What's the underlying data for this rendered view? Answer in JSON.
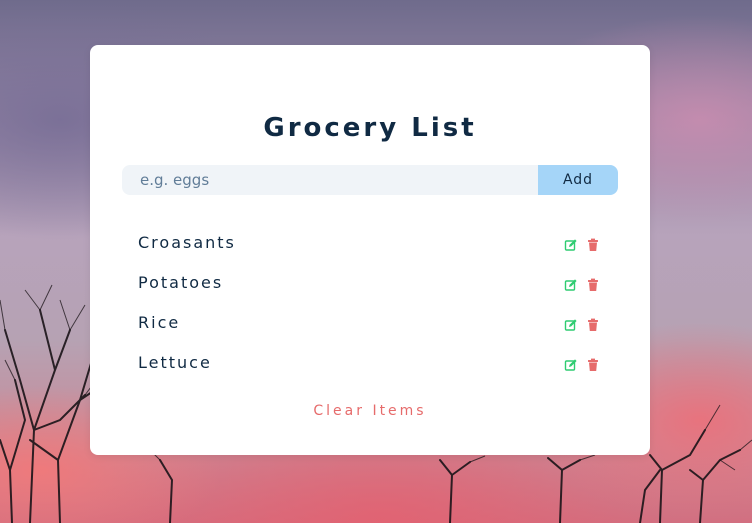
{
  "app": {
    "title": "Grocery List"
  },
  "form": {
    "input_placeholder": "e.g. eggs",
    "input_value": "",
    "add_label": "Add"
  },
  "items": [
    {
      "title": "Croasants",
      "edit_icon": "edit-icon",
      "delete_icon": "trash-icon"
    },
    {
      "title": "Potatoes",
      "edit_icon": "edit-icon",
      "delete_icon": "trash-icon"
    },
    {
      "title": "Rice",
      "edit_icon": "edit-icon",
      "delete_icon": "trash-icon"
    },
    {
      "title": "Lettuce",
      "edit_icon": "edit-icon",
      "delete_icon": "trash-icon"
    }
  ],
  "actions": {
    "clear_label": "Clear Items"
  },
  "colors": {
    "title": "#102a43",
    "input_bg": "#f0f4f8",
    "add_button_bg": "#a5d5f8",
    "edit_icon": "#2ecc71",
    "delete_icon": "#e66b6b",
    "clear_text": "#e66b6b",
    "card_bg": "#ffffff"
  }
}
